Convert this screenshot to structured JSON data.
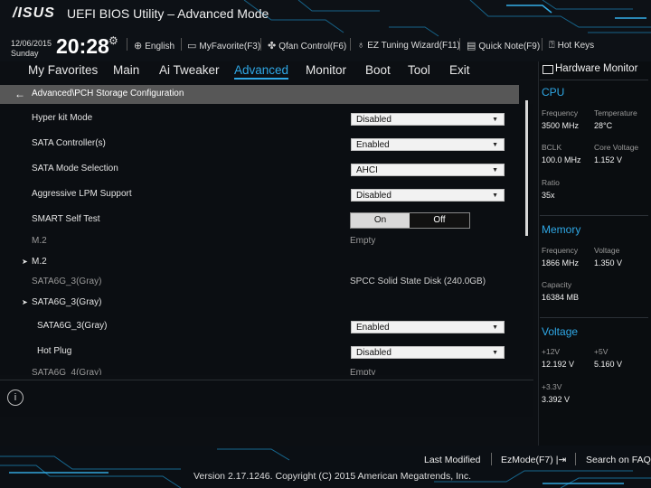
{
  "header": {
    "logo": "/ISUS",
    "title": "UEFI BIOS Utility – Advanced Mode",
    "date": "12/06/2015",
    "day": "Sunday",
    "time": "20:28",
    "settings_icon": "gear-icon",
    "buttons": [
      {
        "icon": "globe-icon",
        "label": "English"
      },
      {
        "icon": "star-icon",
        "label": "MyFavorite(F3)"
      },
      {
        "icon": "fan-icon",
        "label": "Qfan Control(F6)"
      },
      {
        "icon": "bulb-icon",
        "label": "EZ Tuning Wizard(F11)"
      },
      {
        "icon": "note-icon",
        "label": "Quick Note(F9)"
      },
      {
        "icon": "help-icon",
        "label": "Hot Keys"
      }
    ]
  },
  "menu": {
    "items": [
      "My Favorites",
      "Main",
      "Ai Tweaker",
      "Advanced",
      "Monitor",
      "Boot",
      "Tool",
      "Exit"
    ],
    "active": "Advanced"
  },
  "breadcrumb": "Advanced\\PCH Storage Configuration",
  "settings": {
    "hyper_kit": {
      "label": "Hyper kit Mode",
      "value": "Disabled"
    },
    "sata_controller": {
      "label": "SATA Controller(s)",
      "value": "Enabled"
    },
    "sata_mode": {
      "label": "SATA Mode Selection",
      "value": "AHCI"
    },
    "lpm": {
      "label": "Aggressive LPM Support",
      "value": "Disabled"
    },
    "smart": {
      "label": "SMART Self Test",
      "on": "On",
      "off": "Off"
    },
    "m2_info": {
      "label": "M.2",
      "value": "Empty"
    },
    "m2_group": {
      "label": "M.2"
    },
    "sata3_info": {
      "label": "SATA6G_3(Gray)",
      "value": "SPCC Solid State Disk (240.0GB)"
    },
    "sata3_group": {
      "label": "SATA6G_3(Gray)"
    },
    "sata3_port": {
      "label": "SATA6G_3(Gray)",
      "value": "Enabled"
    },
    "hot_plug": {
      "label": "Hot Plug",
      "value": "Disabled"
    },
    "sata4_info": {
      "label": "SATA6G_4(Gray)",
      "value": "Empty"
    }
  },
  "hw_monitor": {
    "title": "Hardware Monitor",
    "cpu": {
      "heading": "CPU",
      "frequency_label": "Frequency",
      "frequency": "3500 MHz",
      "temperature_label": "Temperature",
      "temperature": "28°C",
      "bclk_label": "BCLK",
      "bclk": "100.0 MHz",
      "core_voltage_label": "Core Voltage",
      "core_voltage": "1.152 V",
      "ratio_label": "Ratio",
      "ratio": "35x"
    },
    "memory": {
      "heading": "Memory",
      "frequency_label": "Frequency",
      "frequency": "1866 MHz",
      "voltage_label": "Voltage",
      "voltage": "1.350 V",
      "capacity_label": "Capacity",
      "capacity": "16384 MB"
    },
    "voltage": {
      "heading": "Voltage",
      "v12_label": "+12V",
      "v12": "12.192 V",
      "v5_label": "+5V",
      "v5": "5.160 V",
      "v33_label": "+3.3V",
      "v33": "3.392 V"
    }
  },
  "footer": {
    "last_modified": "Last Modified",
    "ez_mode": "EzMode(F7)",
    "search": "Search on FAQ",
    "version": "Version 2.17.1246. Copyright (C) 2015 American Megatrends, Inc."
  },
  "colors": {
    "accent": "#2fa8e6",
    "background": "#0c0f13"
  }
}
